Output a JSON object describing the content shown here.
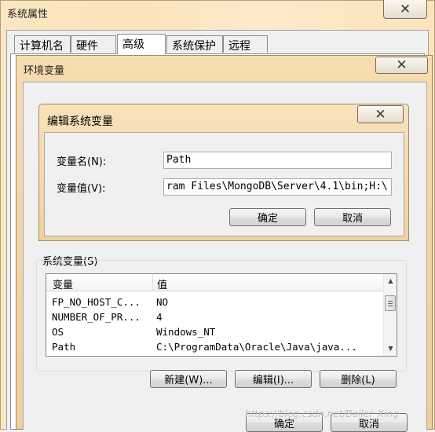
{
  "system_properties": {
    "title": "系统属性",
    "tabs": [
      {
        "label": "计算机名"
      },
      {
        "label": "硬件"
      },
      {
        "label": "高级",
        "active": true
      },
      {
        "label": "系统保护"
      },
      {
        "label": "远程"
      }
    ],
    "buttons": {
      "ok": "确定",
      "cancel": "取消"
    }
  },
  "environment_variables": {
    "title": "环境变量",
    "system_vars_label": "系统变量(S)",
    "columns": [
      "变量",
      "值"
    ],
    "rows": [
      {
        "name": "FP_NO_HOST_C...",
        "value": "NO"
      },
      {
        "name": "NUMBER_OF_PR...",
        "value": "4"
      },
      {
        "name": "OS",
        "value": "Windows_NT"
      },
      {
        "name": "Path",
        "value": "C:\\ProgramData\\Oracle\\Java\\java..."
      }
    ],
    "buttons": {
      "new": "新建(W)...",
      "edit": "编辑(I)...",
      "delete": "删除(L)"
    }
  },
  "edit_dialog": {
    "title": "编辑系统变量",
    "name_label": "变量名(N):",
    "value_label": "变量值(V):",
    "name_value": "Path",
    "value_value": "ram Files\\MongoDB\\Server\\4.1\\bin;H:\\",
    "ok": "确定",
    "cancel": "取消"
  },
  "watermark": "https://blog.csdn.net/Bailer_Xing",
  "colors": {
    "title_bar": "#f7dcae",
    "face": "#f0f0f0"
  }
}
